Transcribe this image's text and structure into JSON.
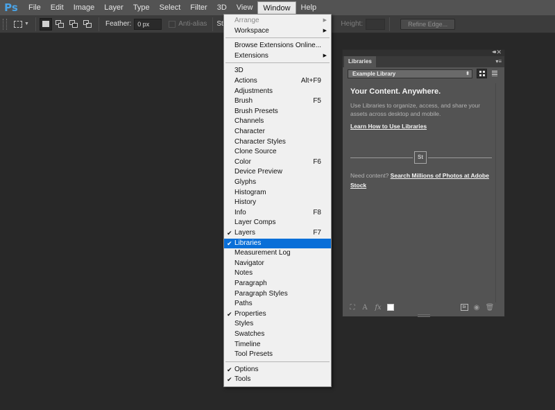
{
  "app": {
    "logo": "Ps"
  },
  "menubar": {
    "items": [
      "File",
      "Edit",
      "Image",
      "Layer",
      "Type",
      "Select",
      "Filter",
      "3D",
      "View",
      "Window",
      "Help"
    ],
    "open_item": "Window"
  },
  "options_bar": {
    "feather_label": "Feather:",
    "feather_value": "0 px",
    "anti_alias_label": "Anti-alias",
    "style_label": "Style:",
    "height_label": "Height:",
    "refine_edge_label": "Refine Edge..."
  },
  "window_menu": {
    "items": [
      {
        "label": "Arrange",
        "submenu": true,
        "disabled": true
      },
      {
        "label": "Workspace",
        "submenu": true
      },
      {
        "label": "Browse Extensions Online..."
      },
      {
        "label": "Extensions",
        "submenu": true
      },
      {
        "label": "3D"
      },
      {
        "label": "Actions",
        "shortcut": "Alt+F9"
      },
      {
        "label": "Adjustments"
      },
      {
        "label": "Brush",
        "shortcut": "F5"
      },
      {
        "label": "Brush Presets"
      },
      {
        "label": "Channels"
      },
      {
        "label": "Character"
      },
      {
        "label": "Character Styles"
      },
      {
        "label": "Clone Source"
      },
      {
        "label": "Color",
        "shortcut": "F6"
      },
      {
        "label": "Device Preview"
      },
      {
        "label": "Glyphs"
      },
      {
        "label": "Histogram"
      },
      {
        "label": "History"
      },
      {
        "label": "Info",
        "shortcut": "F8"
      },
      {
        "label": "Layer Comps"
      },
      {
        "label": "Layers",
        "shortcut": "F7",
        "checked": true
      },
      {
        "label": "Libraries",
        "checked": true,
        "highlighted": true
      },
      {
        "label": "Measurement Log"
      },
      {
        "label": "Navigator"
      },
      {
        "label": "Notes"
      },
      {
        "label": "Paragraph"
      },
      {
        "label": "Paragraph Styles"
      },
      {
        "label": "Paths"
      },
      {
        "label": "Properties",
        "checked": true
      },
      {
        "label": "Styles"
      },
      {
        "label": "Swatches"
      },
      {
        "label": "Timeline"
      },
      {
        "label": "Tool Presets"
      },
      {
        "label": "Options",
        "checked": true
      },
      {
        "label": "Tools",
        "checked": true
      }
    ]
  },
  "libraries_panel": {
    "tab_label": "Libraries",
    "library_select": "Example Library",
    "heading": "Your Content. Anywhere.",
    "description": "Use Libraries to organize, access, and share your assets across desktop and mobile.",
    "learn_link": "Learn How to Use Libraries",
    "badge": "St",
    "need_content": "Need content?",
    "stock_link": "Search Millions of Photos at Adobe Stock",
    "bottom_st": "St"
  }
}
